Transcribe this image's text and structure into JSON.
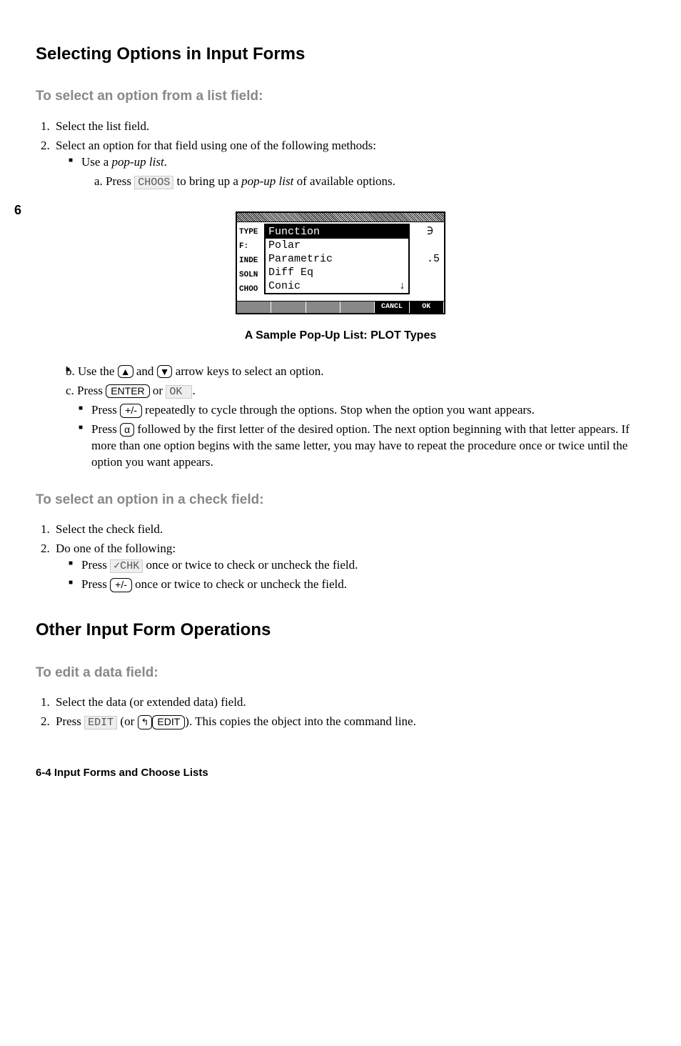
{
  "margin_chapter": "6",
  "title": "Selecting Options in Input Forms",
  "sec1": {
    "heading": "To select an option from a list field:",
    "step1": "Select the list field.",
    "step2": "Select an option for that field using one of the following methods:",
    "bullet_a_pre": "Use a ",
    "bullet_a_em": "pop-up list",
    "bullet_a_post": ".",
    "sub_a_pre": "a.  Press ",
    "sub_a_key": "CHOOS",
    "sub_a_mid": " to bring up a ",
    "sub_a_em": "pop-up list",
    "sub_a_post": " of available options."
  },
  "figure": {
    "bg_labels": [
      "TYPE",
      "F:",
      "INDE",
      "SOLN",
      "CHOO"
    ],
    "bg_right": [
      "∋",
      ".5"
    ],
    "popup_rows": [
      "Function",
      "Polar",
      "Parametric",
      "Diff Eq",
      "Conic"
    ],
    "popup_selected": 0,
    "down_arrow": "↓",
    "menu_labels": [
      "",
      "",
      "",
      "",
      "CANCL",
      "OK"
    ],
    "caption": "A Sample Pop-Up List: PLOT Types"
  },
  "sec1b": {
    "sub_b_pre": "b.  Use the ",
    "sub_b_key1": "▲",
    "sub_b_mid1": " and ",
    "sub_b_key2": "▼",
    "sub_b_post": " arrow keys to select an option.",
    "sub_c_pre": "c.  Press ",
    "sub_c_key1": "ENTER",
    "sub_c_mid": " or ",
    "sub_c_key2": "  OK  ",
    "sub_c_post": ".",
    "bullet_b_pre": "Press ",
    "bullet_b_key": "+/-",
    "bullet_b_post": " repeatedly to cycle through the options. Stop when the option you want appears.",
    "bullet_c_pre": "Press ",
    "bullet_c_key": "α",
    "bullet_c_post": " followed by the first letter of the desired option. The next option beginning with that letter appears. If more than one option begins with the same letter, you may have to repeat the procedure once or twice until the option you want appears."
  },
  "sec2": {
    "heading": "To select an option in a check field:",
    "step1": "Select the check field.",
    "step2": "Do one of the following:",
    "bullet_a_pre": "Press ",
    "bullet_a_key": "✓CHK",
    "bullet_a_post": " once or twice to check or uncheck the field.",
    "bullet_b_pre": "Press ",
    "bullet_b_key": "+/-",
    "bullet_b_post": " once or twice to check or uncheck the field."
  },
  "title2": "Other Input Form Operations",
  "sec3": {
    "heading": "To edit a data field:",
    "step1": "Select the data (or extended data) field.",
    "step2_pre": "Press ",
    "step2_key1": "EDIT",
    "step2_mid1": " (or ",
    "step2_key2a": "↰",
    "step2_key2b": "EDIT",
    "step2_post": "). This copies the object into the command line."
  },
  "footer": "6-4   Input Forms and Choose Lists"
}
